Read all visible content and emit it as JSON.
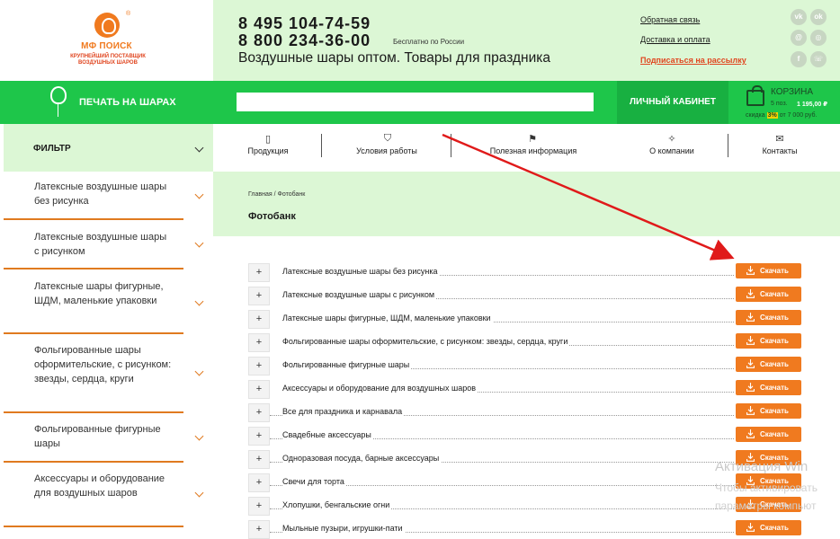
{
  "header": {
    "logo_name": "МФ ПОИСК",
    "logo_sub": "КРУПНЕЙШИЙ ПОСТАВЩИК ВОЗДУШНЫХ ШАРОВ",
    "phone_1": "8 495 104-74-59",
    "phone_2": "8 800 234-36-00",
    "phone_2_note": "Бесплатно по России",
    "slogan": "Воздушные шары оптом. Товары для праздника",
    "links": {
      "feedback": "Обратная связь",
      "delivery": "Доставка и оплата",
      "subscribe": "Подписаться на рассылку"
    },
    "social": [
      "vk",
      "ok",
      "mail",
      "instagram",
      "facebook",
      "viber"
    ]
  },
  "navbar": {
    "print_label": "ПЕЧАТЬ НА ШАРАХ",
    "search_value": "",
    "cabinet_label": "ЛИЧНЫЙ КАБИНЕТ",
    "cart": {
      "title": "КОРЗИНА",
      "count": "5 поз.",
      "sum": "1 195,00 ₽",
      "discount_prefix": "скидка",
      "discount_value": "3%",
      "discount_suffix": "от 7 000 руб."
    }
  },
  "sidebar": {
    "filter_label": "ФИЛЬТР",
    "items": [
      {
        "label": "Латексные воздушные шары без рисунка"
      },
      {
        "label": "Латексные воздушные шары с рисунком"
      },
      {
        "label": "Латексные шары фигурные, ШДМ, маленькие упаковки"
      },
      {
        "label": "Фольгированные шары оформительские, с рисунком: звезды, сердца, круги"
      },
      {
        "label": "Фольгированные фигурные шары"
      },
      {
        "label": "Аксессуары и оборудование для воздушных шаров"
      }
    ]
  },
  "menu": [
    {
      "label": "Продукция",
      "icon": "document-icon"
    },
    {
      "label": "Условия работы",
      "icon": "shield-icon"
    },
    {
      "label": "Полезная информация",
      "icon": "flag-icon"
    },
    {
      "label": "О компании",
      "icon": "magic-wand-icon"
    },
    {
      "label": "Контакты",
      "icon": "envelope-icon"
    }
  ],
  "page": {
    "breadcrumb_home": "Главная",
    "breadcrumb_sep": "/",
    "breadcrumb_current": "Фотобанк",
    "title": "Фотобанк"
  },
  "list": {
    "plus_label": "+",
    "download_label": "Скачать",
    "rows": [
      {
        "label": "Латексные воздушные шары без рисунка",
        "indent": false
      },
      {
        "label": "Латексные воздушные шары с рисунком",
        "indent": false
      },
      {
        "label": "Латексные шары фигурные, ШДМ, маленькие упаковки",
        "indent": false
      },
      {
        "label": "Фольгированные шары оформительские, с рисунком: звезды, сердца, круги",
        "indent": false
      },
      {
        "label": "Фольгированные фигурные шары",
        "indent": false
      },
      {
        "label": "Аксессуары и оборудование для воздушных шаров",
        "indent": false
      },
      {
        "label": "Все для праздника и карнавала",
        "indent": true
      },
      {
        "label": "Свадебные аксессуары",
        "indent": true
      },
      {
        "label": "Одноразовая посуда, барные аксессуары",
        "indent": true
      },
      {
        "label": "Свечи для торта",
        "indent": true
      },
      {
        "label": "Хлопушки, бенгальские огни",
        "indent": true
      },
      {
        "label": "Мыльные пузыри, игрушки-пати",
        "indent": true
      }
    ]
  },
  "watermark": {
    "line1": "Активация Win",
    "line2": "Чтобы активировать",
    "line3": "параметры компьют"
  },
  "colors": {
    "green": "#1ec64a",
    "light_green": "#dcf7d5",
    "orange": "#f07a1f",
    "arrow_red": "#e01a1a"
  }
}
